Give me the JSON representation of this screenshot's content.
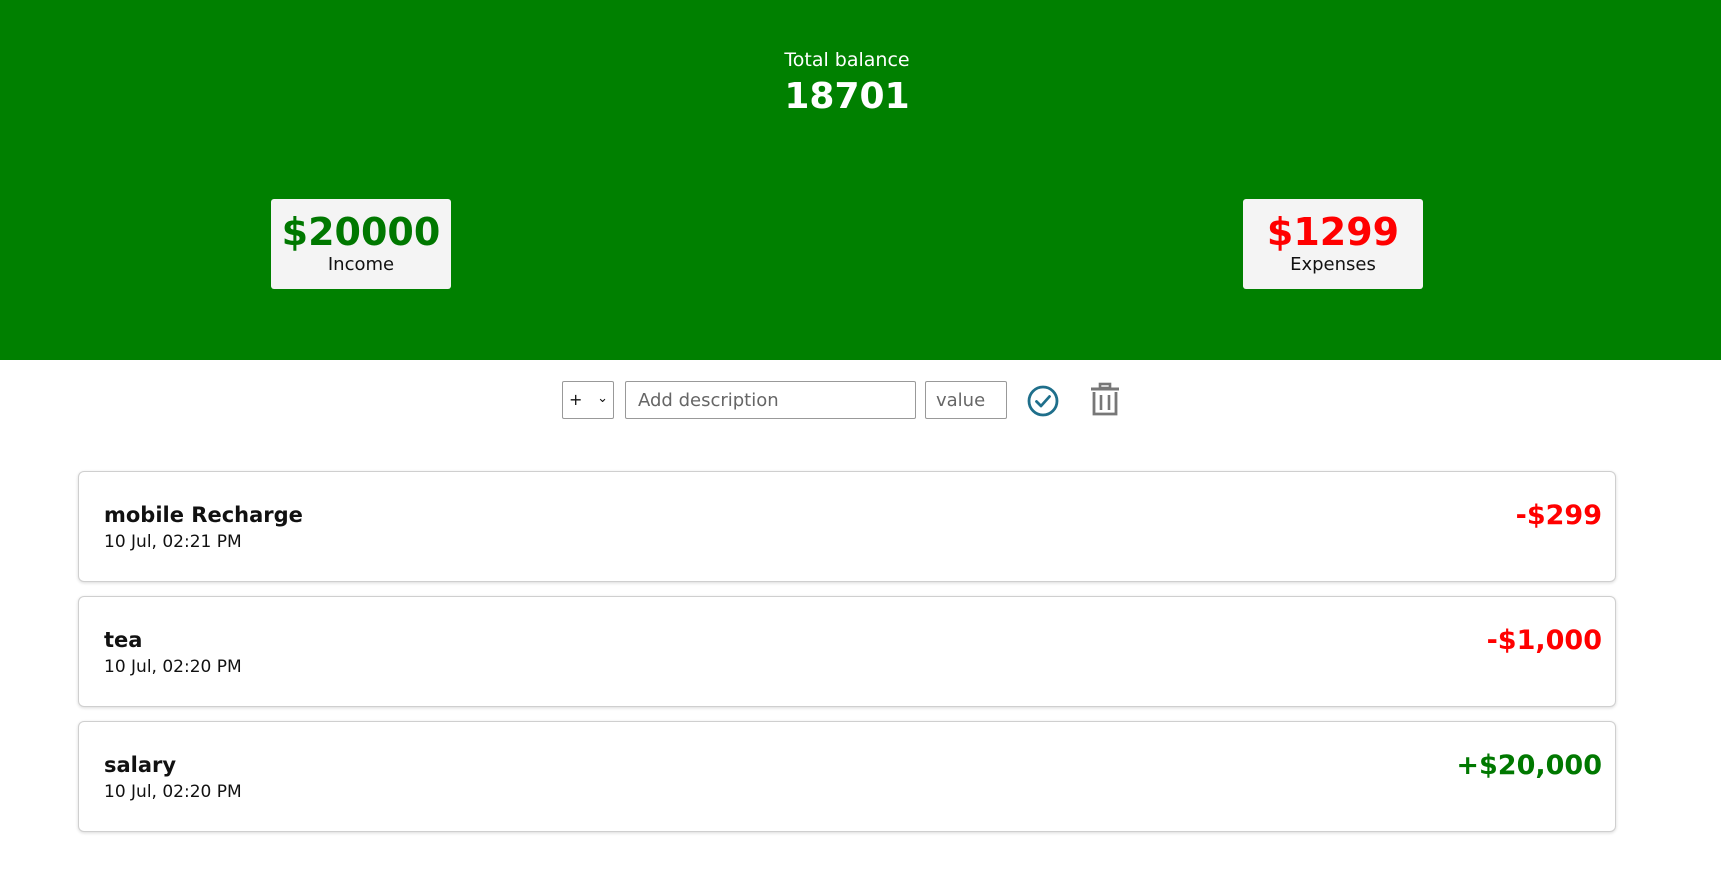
{
  "colors": {
    "header_bg": "#008000",
    "income": "#007800",
    "expense": "#ff0000",
    "confirm_icon": "#1f6f8b",
    "delete_icon": "#777777"
  },
  "header": {
    "balance_label": "Total balance",
    "balance_value": "18701"
  },
  "summary": {
    "income": {
      "amount": "$20000",
      "label": "Income"
    },
    "expenses": {
      "amount": "$1299",
      "label": "Expenses"
    }
  },
  "add_form": {
    "type_selected": "+",
    "description_placeholder": "Add description",
    "value_placeholder": "value",
    "confirm_icon": "check-circle-icon",
    "delete_icon": "trash-icon"
  },
  "transactions": [
    {
      "description": "mobile Recharge",
      "date": "10 Jul, 02:21 PM",
      "amount": "-$299",
      "kind": "expense"
    },
    {
      "description": "tea",
      "date": "10 Jul, 02:20 PM",
      "amount": "-$1,000",
      "kind": "expense"
    },
    {
      "description": "salary",
      "date": "10 Jul, 02:20 PM",
      "amount": "+$20,000",
      "kind": "income"
    }
  ]
}
